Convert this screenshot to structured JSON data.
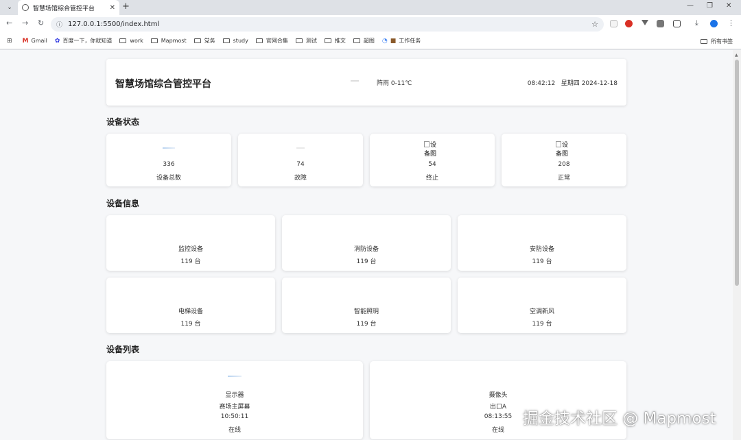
{
  "browser": {
    "tab_title": "智慧场馆综合管控平台",
    "url": "127.0.0.1:5500/index.html",
    "bookmarks": [
      "Gmail",
      "百度一下，你就知道",
      "work",
      "Mapmost",
      "党务",
      "study",
      "官网合集",
      "测试",
      "推文",
      "超图",
      "工作任务"
    ],
    "all_bookmarks": "所有书签"
  },
  "header": {
    "title": "智慧场馆综合管控平台",
    "weather": "阵雨 0-11℃",
    "time": "08:42:12",
    "weekday": "星期四",
    "date": "2024-12-18"
  },
  "sections": {
    "status": "设备状态",
    "info": "设备信息",
    "list": "设备列表"
  },
  "status_cards": [
    {
      "value": "336",
      "label": "设备总数"
    },
    {
      "value": "74",
      "label": "故障"
    },
    {
      "value": "54",
      "label": "终止",
      "img_alt": "设备图"
    },
    {
      "value": "208",
      "label": "正常",
      "img_alt": "设备图"
    }
  ],
  "info_cards": [
    {
      "name": "监控设备",
      "count": "119 台"
    },
    {
      "name": "消防设备",
      "count": "119 台"
    },
    {
      "name": "安防设备",
      "count": "119 台"
    },
    {
      "name": "电梯设备",
      "count": "119 台"
    },
    {
      "name": "智能照明",
      "count": "119 台"
    },
    {
      "name": "空调新风",
      "count": "119 台"
    }
  ],
  "device_list": [
    {
      "type": "显示器",
      "location": "赛场主屏幕",
      "time": "10:50:11",
      "status": "在线"
    },
    {
      "type": "摄像头",
      "location": "出口A",
      "time": "08:13:55",
      "status": "在线"
    }
  ],
  "watermark": "掘金技术社区 @ Mapmost"
}
